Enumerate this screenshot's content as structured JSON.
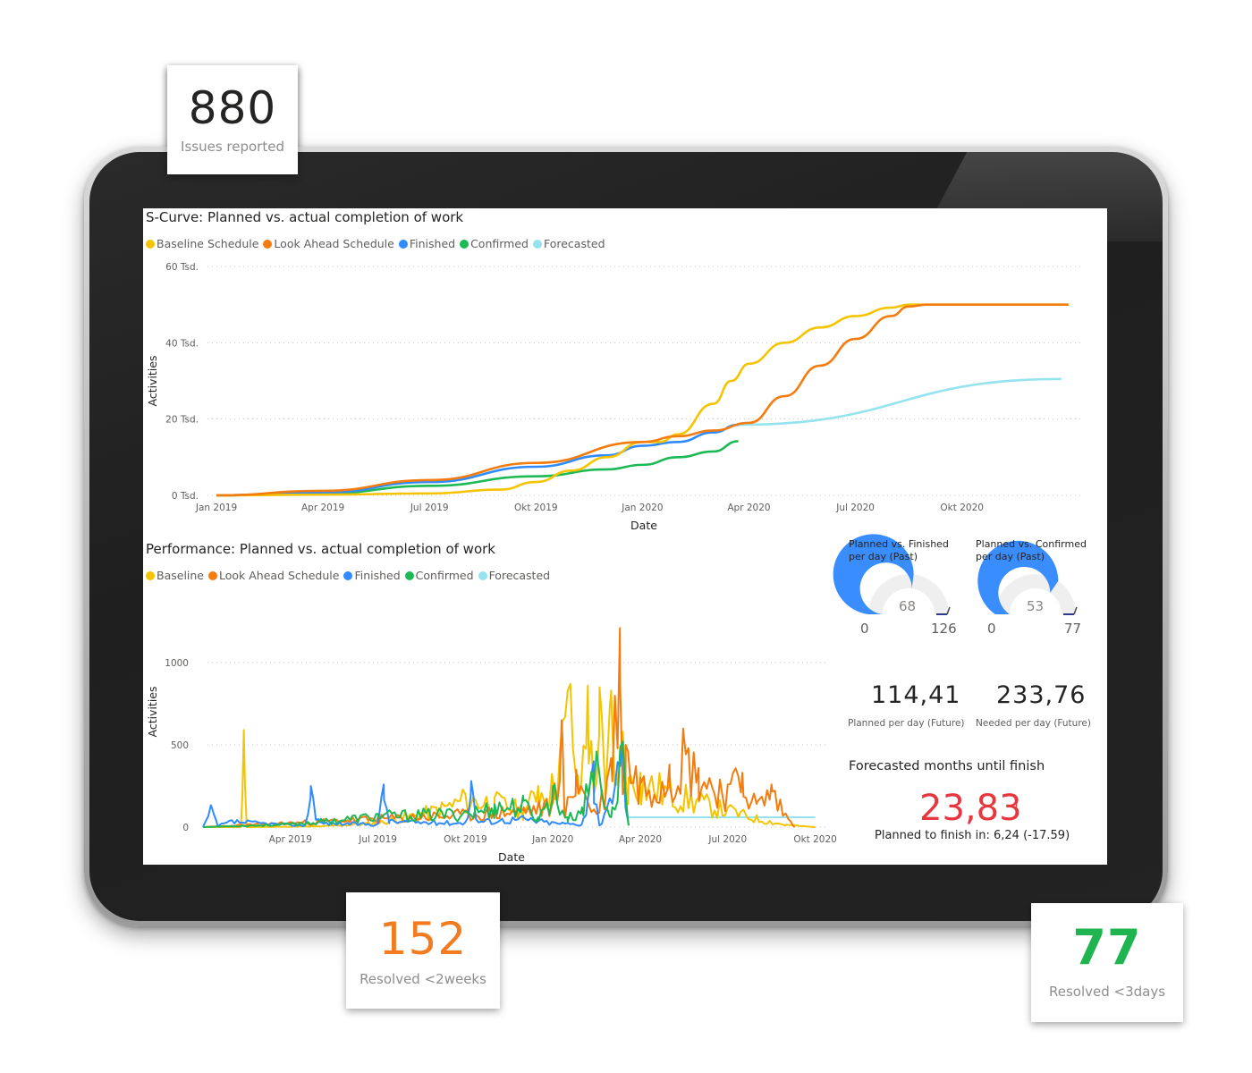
{
  "cards": {
    "issues": {
      "value": "880",
      "label": "Issues reported",
      "color": "#252423"
    },
    "resolved_2w": {
      "value": "152",
      "label": "Resolved <2weeks",
      "color": "#f47c20"
    },
    "resolved_3d": {
      "value": "77",
      "label": "Resolved <3days",
      "color": "#1fb44f"
    }
  },
  "legend_colors": {
    "baseline": "#f5c400",
    "lookahead": "#f47c0e",
    "finished": "#2f8bff",
    "confirmed": "#1db954",
    "forecasted": "#94e3ee"
  },
  "scurve": {
    "title": "S-Curve: Planned vs. actual completion of work",
    "legend": [
      "Baseline Schedule",
      "Look Ahead Schedule",
      "Finished",
      "Confirmed",
      "Forecasted"
    ],
    "xlabel": "Date",
    "ylabel": "Activities"
  },
  "performance": {
    "title": "Performance: Planned vs. actual completion of work",
    "legend": [
      "Baseline",
      "Look Ahead Schedule",
      "Finished",
      "Confirmed",
      "Forecasted"
    ],
    "xlabel": "Date",
    "ylabel": "Activities"
  },
  "gauges": [
    {
      "title_line1": "Planned vs. Finished",
      "title_line2": "per day (Past)",
      "value": "68",
      "min": "0",
      "max": "126",
      "fraction": 0.54
    },
    {
      "title_line1": "Planned vs. Confirmed",
      "title_line2": "per day (Past)",
      "value": "53",
      "min": "0",
      "max": "77",
      "fraction": 0.69
    }
  ],
  "kpis": [
    {
      "value": "114,41",
      "label": "Planned per day (Future)"
    },
    {
      "value": "233,76",
      "label": "Needed per day (Future)"
    }
  ],
  "forecast": {
    "title": "Forecasted months until finish",
    "value": "23,83",
    "alert": "!",
    "subtitle": "Planned to finish in: 6,24 (-17.59)",
    "color": "#e8363f"
  },
  "chart_data": [
    {
      "type": "line",
      "title": "S-Curve: Planned vs. actual completion of work",
      "xlabel": "Date",
      "ylabel": "Activities",
      "x_ticks": [
        "Jan 2019",
        "Apr 2019",
        "Jul 2019",
        "Okt 2019",
        "Jan 2020",
        "Apr 2020",
        "Jul 2020",
        "Okt 2020"
      ],
      "y_ticks": [
        "0 Tsd.",
        "20 Tsd.",
        "40 Tsd.",
        "60 Tsd."
      ],
      "ylim": [
        0,
        60000
      ],
      "xlim_months": [
        0,
        24
      ],
      "grid": true,
      "legend_position": "top-left",
      "series": [
        {
          "name": "Baseline Schedule",
          "key": "baseline",
          "x_months": [
            0,
            3,
            6,
            8,
            9,
            10,
            11,
            12,
            12.5,
            13,
            14,
            14.5,
            15,
            16,
            17,
            18,
            19,
            19.5,
            24
          ],
          "values": [
            0,
            200,
            500,
            1500,
            3500,
            6500,
            10000,
            14000,
            14000,
            16000,
            24000,
            30000,
            34500,
            40000,
            44000,
            47000,
            49200,
            50000,
            50000
          ]
        },
        {
          "name": "Look Ahead Schedule",
          "key": "lookahead",
          "x_months": [
            0,
            3,
            6,
            9,
            12,
            13,
            14,
            15,
            16,
            17,
            18,
            19,
            19.5,
            20,
            24
          ],
          "values": [
            0,
            1200,
            4000,
            8500,
            14000,
            15500,
            17000,
            19000,
            26000,
            34000,
            41000,
            47000,
            49500,
            50000,
            50000
          ]
        },
        {
          "name": "Finished",
          "key": "finished",
          "x_months": [
            0,
            3,
            6,
            9,
            11,
            12,
            13,
            14,
            14.7
          ],
          "values": [
            0,
            800,
            3500,
            7500,
            10500,
            13000,
            14000,
            16500,
            18500
          ]
        },
        {
          "name": "Confirmed",
          "key": "confirmed",
          "x_months": [
            0,
            3,
            6,
            9,
            11,
            12,
            13,
            14,
            14.7
          ],
          "values": [
            0,
            500,
            2500,
            5000,
            6800,
            8000,
            10000,
            11500,
            14200
          ]
        },
        {
          "name": "Forecasted",
          "key": "forecasted",
          "x_months": [
            14.7,
            23.8
          ],
          "values": [
            18500,
            30500
          ]
        }
      ]
    },
    {
      "type": "line",
      "title": "Performance: Planned vs. actual completion of work",
      "xlabel": "Date",
      "ylabel": "Activities",
      "x_ticks": [
        "Apr 2019",
        "Jul 2019",
        "Okt 2019",
        "Jan 2020",
        "Apr 2020",
        "Jul 2020",
        "Okt 2020"
      ],
      "y_ticks": [
        "0",
        "500",
        "1000"
      ],
      "ylim": [
        0,
        1250
      ],
      "xlim_months": [
        0,
        21
      ],
      "grid": true,
      "legend_position": "top-left",
      "series": [
        {
          "name": "Baseline",
          "key": "baseline",
          "x_months": [
            0,
            1.3,
            1.4,
            1.5,
            4,
            6,
            8,
            9,
            10,
            11,
            11.5,
            12,
            12.6,
            12.9,
            13.2,
            13.4,
            13.6,
            13.8,
            14.0,
            14.2,
            14.4,
            14.6,
            15,
            16,
            17,
            18,
            19,
            20,
            21
          ],
          "values": [
            0,
            0,
            590,
            0,
            5,
            30,
            120,
            200,
            180,
            120,
            250,
            280,
            870,
            200,
            860,
            220,
            850,
            200,
            830,
            260,
            580,
            300,
            330,
            250,
            180,
            120,
            60,
            15,
            0
          ]
        },
        {
          "name": "Look Ahead Schedule",
          "key": "lookahead",
          "x_months": [
            0,
            3,
            6,
            9,
            11,
            12,
            12.3,
            12.4,
            12.8,
            13.5,
            14.0,
            14.3,
            14.4,
            14.5,
            15,
            16,
            16.5,
            17,
            18,
            18.5,
            19,
            19.5,
            20,
            20.3
          ],
          "values": [
            0,
            30,
            60,
            90,
            120,
            150,
            650,
            80,
            350,
            80,
            420,
            1210,
            200,
            500,
            300,
            380,
            540,
            360,
            260,
            330,
            150,
            260,
            80,
            0
          ]
        },
        {
          "name": "Finished",
          "key": "finished",
          "x_months": [
            0,
            0.3,
            0.5,
            1.0,
            3.5,
            3.7,
            4,
            6,
            6.2,
            6.4,
            9,
            9.2,
            9.4,
            11,
            12,
            13,
            13.4,
            13.6,
            14,
            14.4,
            14.6
          ],
          "values": [
            0,
            120,
            10,
            40,
            10,
            250,
            30,
            20,
            260,
            40,
            30,
            280,
            40,
            60,
            30,
            20,
            400,
            10,
            160,
            500,
            10
          ]
        },
        {
          "name": "Confirmed",
          "key": "confirmed",
          "x_months": [
            0,
            3,
            6,
            9,
            10,
            11,
            11.5,
            12,
            12.5,
            13,
            13.5,
            14,
            14.4,
            14.6
          ],
          "values": [
            0,
            20,
            80,
            100,
            140,
            160,
            60,
            250,
            60,
            120,
            460,
            60,
            520,
            10
          ]
        },
        {
          "name": "Forecasted",
          "key": "forecasted",
          "x_months": [
            14.6,
            21
          ],
          "values": [
            60,
            60
          ]
        }
      ]
    }
  ]
}
